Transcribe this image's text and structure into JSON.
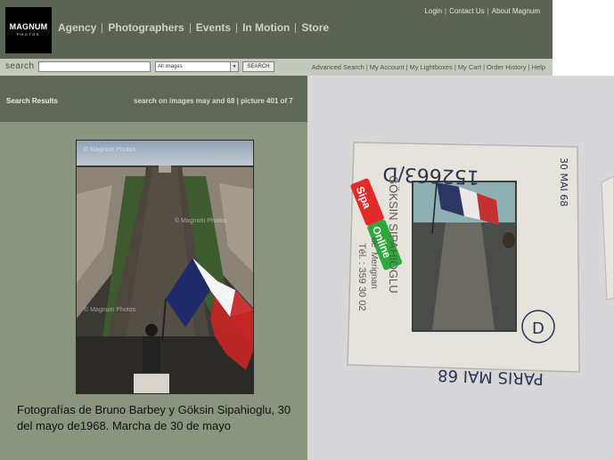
{
  "website": {
    "logo": {
      "line1": "MAGNUM",
      "line2": "PHOTOS"
    },
    "nav": [
      "Agency",
      "Photographers",
      "Events",
      "In Motion",
      "Store"
    ],
    "top_links": [
      "Login",
      "Contact Us",
      "About Magnum"
    ],
    "search": {
      "label": "search",
      "input_value": "",
      "scope_selected": "All images",
      "button_label": "SEARCH"
    },
    "account_links": [
      "Advanced Search",
      "My Account",
      "My Lightboxes",
      "My Cart",
      "Order History",
      "Help"
    ],
    "results": {
      "title": "Search Results",
      "info": "search on images may and 68 | picture 401 of 7"
    },
    "photo": {
      "watermark": "© Magnum Photos"
    }
  },
  "caption": "Fotografías de Bruno Barbey y Göksin Sipahioglu, 30 del mayo de1968. Marcha de 30 de mayo",
  "slide": {
    "handwritten_number": "152663/D",
    "photographer_stamp": "GÖKSIN SIPAHIOGLU",
    "agency_label": "Sipa",
    "agency_label_2": "Online",
    "address_line1": "de",
    "address_line2": "Merignan",
    "phone": "Tél. : 359 30 02",
    "bottom_text": "PARIS MAI 68",
    "right_text": "30 MAI 68",
    "circle_mark": "D"
  }
}
